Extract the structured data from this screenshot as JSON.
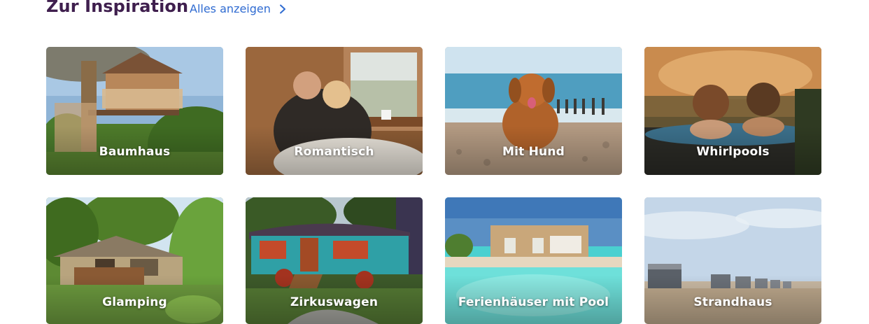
{
  "header": {
    "title": "Zur Inspiration",
    "show_all_label": "Alles anzeigen",
    "show_all_icon": "chevron-right-icon"
  },
  "colors": {
    "title": "#3f1f4e",
    "link": "#2f6bd1",
    "label_text": "#ffffff"
  },
  "cards": [
    {
      "label": "Baumhaus",
      "image": "treehouse-photo"
    },
    {
      "label": "Romantisch",
      "image": "couple-cabin-photo"
    },
    {
      "label": "Mit Hund",
      "image": "dog-beach-photo"
    },
    {
      "label": "Whirlpools",
      "image": "hot-tub-photo"
    },
    {
      "label": "Glamping",
      "image": "glamping-tent-photo"
    },
    {
      "label": "Zirkuswagen",
      "image": "circus-wagon-photo"
    },
    {
      "label": "Ferienhäuser mit Pool",
      "image": "pool-house-photo"
    },
    {
      "label": "Strandhaus",
      "image": "beach-houses-photo"
    }
  ]
}
